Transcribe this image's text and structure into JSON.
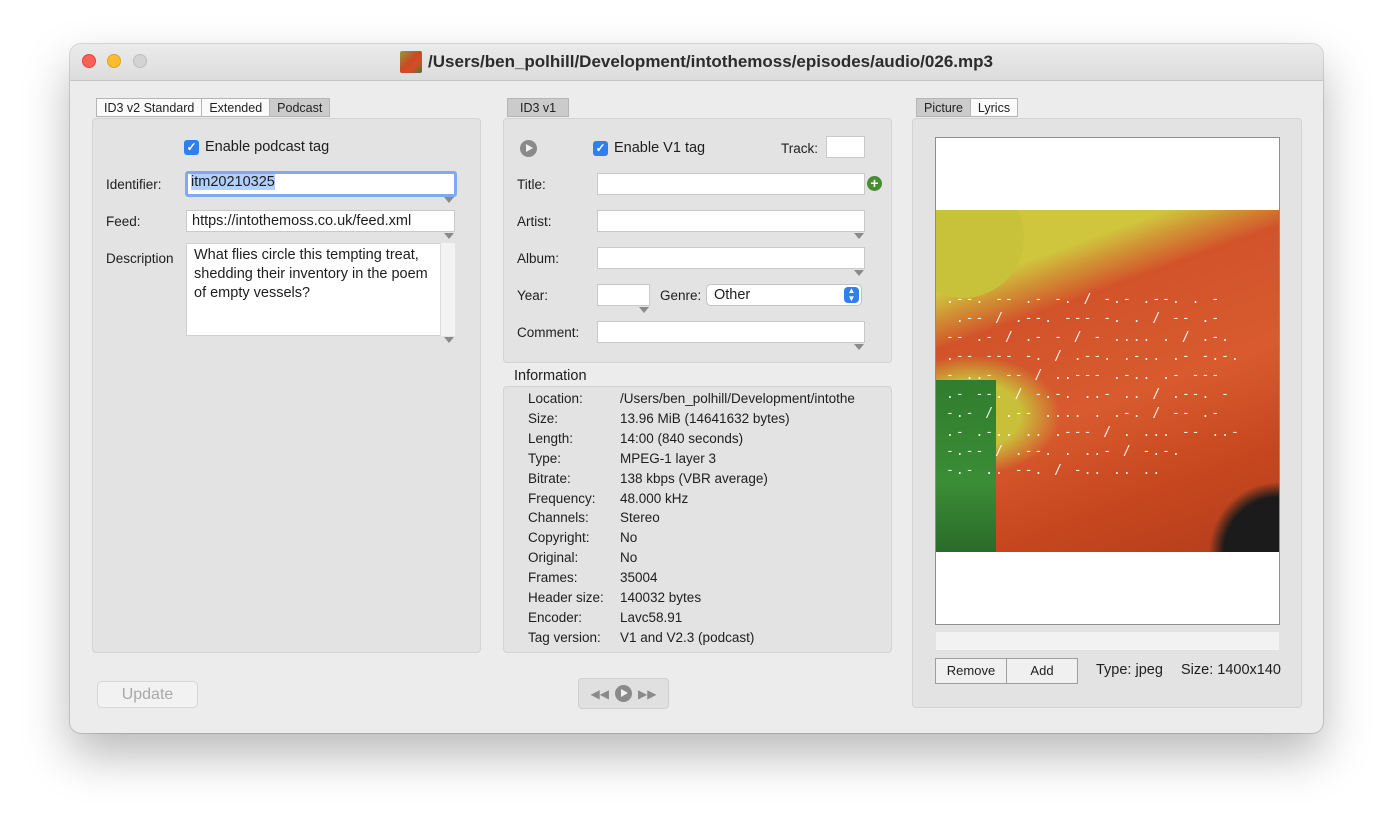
{
  "window": {
    "title": "/Users/ben_polhill/Development/intothemoss/episodes/audio/026.mp3"
  },
  "left_tabs": [
    "ID3 v2 Standard",
    "Extended",
    "Podcast"
  ],
  "podcast": {
    "enable_label": "Enable podcast tag",
    "identifier_label": "Identifier:",
    "identifier_value": "itm20210325",
    "feed_label": "Feed:",
    "feed_value": "https://intothemoss.co.uk/feed.xml",
    "description_label": "Description",
    "description_value": "What flies circle this tempting treat, shedding their inventory in the poem of empty vessels?"
  },
  "v1": {
    "tab_label": "ID3 v1",
    "enable_label": "Enable V1 tag",
    "track_label": "Track:",
    "track_value": "",
    "title_label": "Title:",
    "title_value": "",
    "artist_label": "Artist:",
    "artist_value": "",
    "album_label": "Album:",
    "album_value": "",
    "year_label": "Year:",
    "year_value": "",
    "genre_label": "Genre:",
    "genre_value": "Other",
    "comment_label": "Comment:",
    "comment_value": ""
  },
  "information": {
    "heading": "Information",
    "rows": [
      {
        "key": "Location:",
        "value": "/Users/ben_polhill/Development/intothe"
      },
      {
        "key": "Size:",
        "value": "13.96 MiB (14641632 bytes)"
      },
      {
        "key": "Length:",
        "value": "14:00 (840 seconds)"
      },
      {
        "key": "Type:",
        "value": "MPEG-1 layer 3"
      },
      {
        "key": "Bitrate:",
        "value": "138 kbps (VBR average)"
      },
      {
        "key": "Frequency:",
        "value": "48.000 kHz"
      },
      {
        "key": "Channels:",
        "value": "Stereo"
      },
      {
        "key": "Copyright:",
        "value": "No"
      },
      {
        "key": "Original:",
        "value": "No"
      },
      {
        "key": "Frames:",
        "value": "35004"
      },
      {
        "key": "Header size:",
        "value": "140032 bytes"
      },
      {
        "key": "Encoder:",
        "value": "Lavc58.91"
      },
      {
        "key": "Tag version:",
        "value": "V1 and V2.3 (podcast)"
      }
    ]
  },
  "picture_tabs": [
    "Picture",
    "Lyrics"
  ],
  "picture": {
    "remove_label": "Remove",
    "add_label": "Add",
    "type_text": "Type: jpeg",
    "size_text": "Size: 1400x140"
  },
  "update_label": "Update",
  "colors": {
    "accent": "#2f80ed",
    "focus_ring": "#7fa9f0",
    "add_green": "#4a8c34"
  }
}
